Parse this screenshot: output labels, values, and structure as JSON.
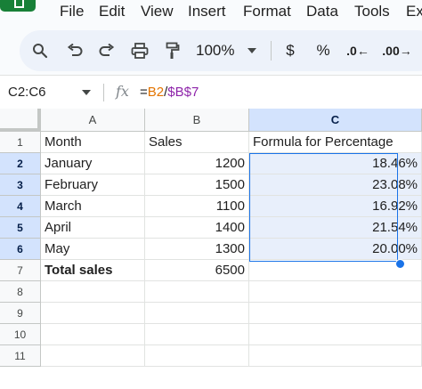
{
  "menu": [
    "File",
    "Edit",
    "View",
    "Insert",
    "Format",
    "Data",
    "Tools",
    "Ex"
  ],
  "toolbar": {
    "zoom": "100%",
    "currency": "$",
    "percent": "%",
    "decrease_decimal": ".0←",
    "increase_decimal": ".00→"
  },
  "formula_bar": {
    "name_box": "C2:C6",
    "fx_label": "fx",
    "formula_eq": "=",
    "formula_ref1": "B2",
    "formula_slash": "/",
    "formula_ref2": "$B$7"
  },
  "sheet": {
    "columns": [
      "A",
      "B",
      "C"
    ],
    "rows": [
      "1",
      "2",
      "3",
      "4",
      "5",
      "6",
      "7",
      "8",
      "9",
      "10",
      "11"
    ],
    "cells": [
      [
        "Month",
        "Sales",
        "Formula for Percentage"
      ],
      [
        "January",
        "1200",
        "18.46%"
      ],
      [
        "February",
        "1500",
        "23.08%"
      ],
      [
        "March",
        "1100",
        "16.92%"
      ],
      [
        "April",
        "1400",
        "21.54%"
      ],
      [
        "May",
        "1300",
        "20.00%"
      ],
      [
        "Total sales",
        "6500",
        ""
      ],
      [
        "",
        "",
        ""
      ],
      [
        "",
        "",
        ""
      ],
      [
        "",
        "",
        ""
      ],
      [
        "",
        "",
        ""
      ]
    ],
    "selection": "C2:C6",
    "colors": {
      "selection": "#1a73e8",
      "selected_header": "#d3e3fd",
      "selected_fill": "#e8effb"
    }
  },
  "icons": [
    "sheets-logo",
    "search-icon",
    "undo-icon",
    "redo-icon",
    "print-icon",
    "paint-format-icon",
    "zoom-dropdown-icon"
  ]
}
